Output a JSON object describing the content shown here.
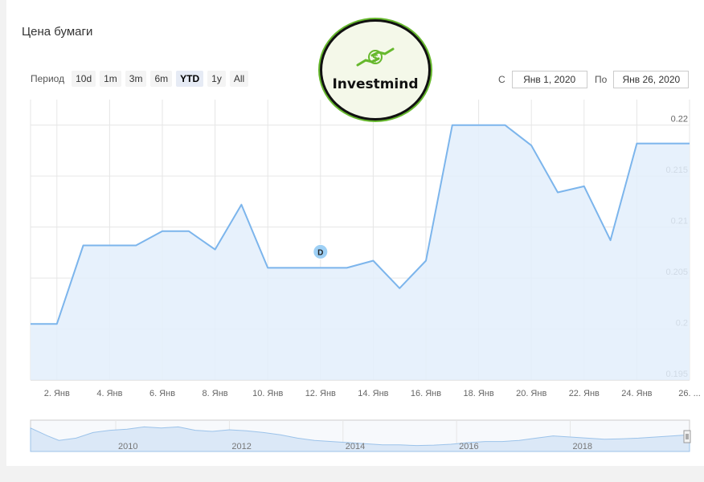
{
  "header": {
    "title": "Цена бумаги"
  },
  "range_selector": {
    "label": "Период",
    "buttons": [
      "10d",
      "1m",
      "3m",
      "6m",
      "YTD",
      "1y",
      "All"
    ],
    "selected": "YTD"
  },
  "date_range": {
    "from_label": "С",
    "from_value": "Янв 1, 2020",
    "to_label": "По",
    "to_value": "Янв 26, 2020"
  },
  "logo": {
    "text": "Investmind",
    "color": "#66b82d"
  },
  "flag": {
    "text": "D",
    "x": 12,
    "color": "#9ed0f5"
  },
  "colors": {
    "line": "#7cb5ec",
    "fill": "#e3eefb",
    "grid": "#e6e6e6"
  },
  "chart_data": {
    "type": "area",
    "x": [
      1,
      2,
      3,
      4,
      5,
      6,
      7,
      8,
      9,
      10,
      11,
      12,
      13,
      14,
      15,
      16,
      17,
      18,
      19,
      20,
      21,
      22,
      23,
      24,
      25,
      26
    ],
    "values": [
      0.2005,
      0.2005,
      0.2082,
      0.2082,
      0.2082,
      0.2096,
      0.2096,
      0.2078,
      0.2122,
      0.206,
      0.206,
      0.206,
      0.206,
      0.2067,
      0.204,
      0.2067,
      0.22,
      0.22,
      0.22,
      0.218,
      0.2134,
      0.214,
      0.2087,
      0.2182,
      0.2182,
      0.2182
    ],
    "xlim": [
      1,
      26
    ],
    "ylim": [
      0.195,
      0.2225
    ],
    "y_ticks": [
      {
        "value": 0.195,
        "label": "0.195"
      },
      {
        "value": 0.2,
        "label": "0.2"
      },
      {
        "value": 0.205,
        "label": "0.205"
      },
      {
        "value": 0.21,
        "label": "0.21"
      },
      {
        "value": 0.215,
        "label": "0.215"
      },
      {
        "value": 0.22,
        "label": "0.22"
      }
    ],
    "x_ticks": [
      {
        "value": 2,
        "label": "2. Янв"
      },
      {
        "value": 4,
        "label": "4. Янв"
      },
      {
        "value": 6,
        "label": "6. Янв"
      },
      {
        "value": 8,
        "label": "8. Янв"
      },
      {
        "value": 10,
        "label": "10. Янв"
      },
      {
        "value": 12,
        "label": "12. Янв"
      },
      {
        "value": 14,
        "label": "14. Янв"
      },
      {
        "value": 16,
        "label": "16. Янв"
      },
      {
        "value": 18,
        "label": "18. Янв"
      },
      {
        "value": 20,
        "label": "20. Янв"
      },
      {
        "value": 22,
        "label": "22. Янв"
      },
      {
        "value": 24,
        "label": "24. Янв"
      },
      {
        "value": 26,
        "label": "26. ..."
      }
    ],
    "grid": true,
    "y_axis_side": "right"
  },
  "navigator": {
    "year_labels": [
      "2010",
      "2012",
      "2014",
      "2016",
      "2018"
    ],
    "year_positions": [
      2010,
      2012,
      2014,
      2016,
      2018
    ],
    "xlim": [
      2008.5,
      2020.1
    ],
    "ylim": [
      0,
      1
    ],
    "series_x": [
      2008.5,
      2008.8,
      2009.0,
      2009.3,
      2009.6,
      2009.9,
      2010.2,
      2010.5,
      2010.8,
      2011.1,
      2011.4,
      2011.7,
      2012.0,
      2012.3,
      2012.6,
      2012.9,
      2013.2,
      2013.5,
      2013.8,
      2014.1,
      2014.4,
      2014.7,
      2015.0,
      2015.3,
      2015.6,
      2015.9,
      2016.2,
      2016.5,
      2016.8,
      2017.1,
      2017.4,
      2017.7,
      2018.0,
      2018.3,
      2018.6,
      2018.9,
      2019.2,
      2019.5,
      2019.8,
      2020.1
    ],
    "series_y": [
      0.9,
      0.55,
      0.35,
      0.45,
      0.7,
      0.8,
      0.85,
      0.95,
      0.9,
      0.95,
      0.8,
      0.75,
      0.82,
      0.78,
      0.7,
      0.6,
      0.45,
      0.35,
      0.3,
      0.25,
      0.2,
      0.15,
      0.15,
      0.12,
      0.14,
      0.18,
      0.25,
      0.3,
      0.3,
      0.35,
      0.45,
      0.55,
      0.5,
      0.45,
      0.4,
      0.42,
      0.45,
      0.5,
      0.55,
      0.6
    ]
  }
}
